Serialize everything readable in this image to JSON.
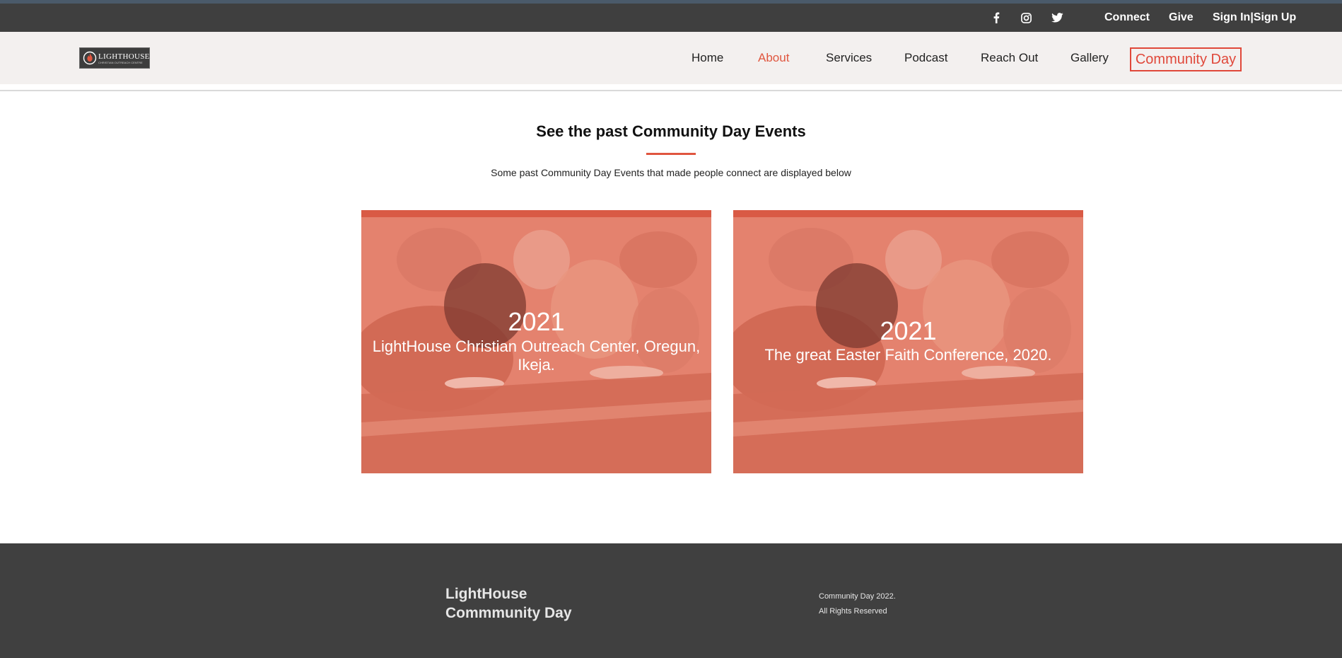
{
  "topbar": {
    "social": [
      {
        "icon": "facebook-icon"
      },
      {
        "icon": "instagram-icon"
      },
      {
        "icon": "twitter-icon"
      }
    ],
    "connect": "Connect",
    "give": "Give",
    "signin": "Sign In|Sign Up"
  },
  "header": {
    "logo_text": "LIGHTHOUSE",
    "logo_sub": "CHRISTIAN OUTREACH CENTRE",
    "nav": [
      {
        "label": "Home"
      },
      {
        "label": "About"
      },
      {
        "label": "Services"
      },
      {
        "label": "Podcast"
      },
      {
        "label": "Reach Out"
      },
      {
        "label": "Gallery"
      }
    ],
    "cta": "Community Day"
  },
  "main": {
    "title": "See the past Community Day Events",
    "subtitle": "Some past Community Day Events that made people connect are displayed below",
    "cards": [
      {
        "year": "2021",
        "caption": "LightHouse Christian Outreach Center, Oregun, Ikeja."
      },
      {
        "year": "2021",
        "caption": "The great Easter Faith Conference, 2020."
      }
    ]
  },
  "footer": {
    "brand": "LightHouse Commmunity Day",
    "copy_line1": "Community Day 2022.",
    "copy_line2": "All Rights Reserved"
  },
  "colors": {
    "accent": "#e0563f",
    "topbar": "#3f3f3f",
    "navbar": "#f3f0ef",
    "footer": "#404040",
    "card_overlay": "#e06a55"
  }
}
